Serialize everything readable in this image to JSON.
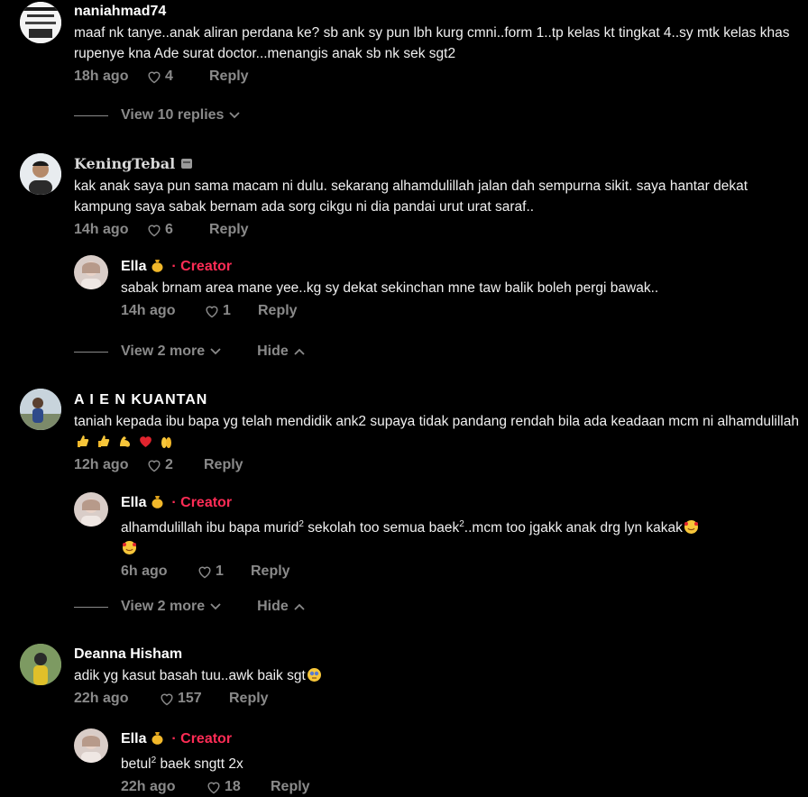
{
  "colors": {
    "background": "#000000",
    "text": "#ffffff",
    "muted": "#8a8a8a",
    "creator": "#fe2c55"
  },
  "comments": [
    {
      "username": "naniahmad74",
      "text": "maaf nk tanye..anak aliran perdana ke? sb ank sy pun lbh kurg cmni..form 1..tp kelas kt tingkat 4..sy mtk kelas khas rupenye kna Ade surat doctor...menangis anak sb nk sek sgt2",
      "time": "18h ago",
      "likes": "4",
      "reply_label": "Reply",
      "view_replies": "View 10 replies"
    },
    {
      "username": "KeningTebal",
      "text": "kak anak saya pun sama macam ni dulu. sekarang alhamdulillah jalan dah sempurna sikit. saya hantar dekat kampung saya sabak bernam ada sorg cikgu ni dia pandai urut urat saraf..",
      "time": "14h ago",
      "likes": "6",
      "reply_label": "Reply",
      "reply": {
        "username": "Ella",
        "creator_label": "· Creator",
        "text": "sabak brnam area mane yee..kg sy dekat sekinchan mne taw balik boleh pergi bawak..",
        "time": "14h ago",
        "likes": "1",
        "reply_label": "Reply"
      },
      "view_more": "View 2 more",
      "hide": "Hide"
    },
    {
      "username": "A I E N KUANTAN",
      "text": "taniah kepada ibu bapa yg telah mendidik ank2 supaya tidak pandang rendah bila ada keadaan mcm ni alhamdulillah",
      "time": "12h ago",
      "likes": "2",
      "reply_label": "Reply",
      "reply": {
        "username": "Ella",
        "creator_label": "· Creator",
        "text_a": "alhamdulillah ibu bapa murid",
        "text_b": " sekolah too semua baek",
        "text_c": "..mcm too jgakk anak drg lyn kakak",
        "sup": "2",
        "time": "6h ago",
        "likes": "1",
        "reply_label": "Reply"
      },
      "view_more": "View 2 more",
      "hide": "Hide"
    },
    {
      "username": "Deanna Hisham",
      "text": "adik yg kasut basah tuu..awk baik sgt",
      "time": "22h ago",
      "likes": "157",
      "reply_label": "Reply",
      "reply": {
        "username": "Ella",
        "creator_label": "· Creator",
        "text_a": "betul",
        "text_b": " baek sngtt 2x",
        "sup": "2",
        "time": "22h ago",
        "likes": "18",
        "reply_label": "Reply"
      }
    }
  ]
}
